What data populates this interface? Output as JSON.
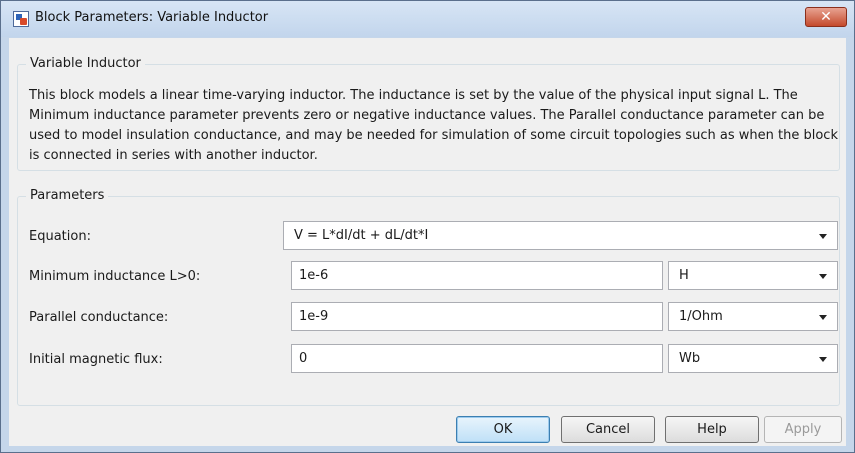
{
  "window": {
    "title": "Block Parameters: Variable Inductor",
    "close_glyph": "✕"
  },
  "block": {
    "group_title": "Variable Inductor",
    "description": "This block models a linear time-varying inductor. The inductance is set by the value of the physical input signal L. The Minimum inductance parameter prevents zero or negative inductance values. The Parallel conductance parameter can be used to model insulation conductance, and may be needed for simulation of some circuit topologies such as when the block is connected in series with another inductor."
  },
  "parameters": {
    "group_title": "Parameters",
    "equation": {
      "label": "Equation:",
      "value": "V = L*dI/dt + dL/dt*I"
    },
    "min_inductance": {
      "label": "Minimum inductance L>0:",
      "value": "1e-6",
      "unit": "H"
    },
    "parallel_conductance": {
      "label": "Parallel conductance:",
      "value": "1e-9",
      "unit": "1/Ohm"
    },
    "initial_flux": {
      "label": "Initial magnetic flux:",
      "value": "0",
      "unit": "Wb"
    }
  },
  "buttons": {
    "ok": "OK",
    "cancel": "Cancel",
    "help": "Help",
    "apply": "Apply"
  },
  "colors": {
    "close_button": "#c44a2c",
    "window_frame": "#c5d6ea",
    "default_button_border": "#3c7fb1"
  }
}
